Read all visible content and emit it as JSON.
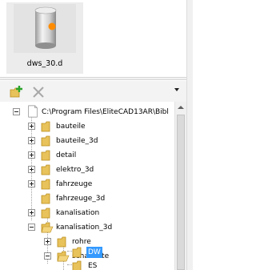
{
  "preview": {
    "thumbnail_label": "dws_30.d"
  },
  "toolbar": {
    "add_folder_icon": "folder-add-icon",
    "delete_icon": "delete-x-icon",
    "dropdown_icon": "dropdown-arrow-icon"
  },
  "tree": {
    "root_label": "C:\\Program Files\\EliteCAD13AR\\Bibl",
    "items": [
      {
        "label": "bauteile",
        "expanded": false
      },
      {
        "label": "bauteile_3d",
        "expanded": false
      },
      {
        "label": "detail",
        "expanded": false
      },
      {
        "label": "elektro_3d",
        "expanded": false
      },
      {
        "label": "fahrzeuge",
        "expanded": false
      },
      {
        "label": "fahrzeuge_3d",
        "expanded": false
      },
      {
        "label": "kanalisation",
        "expanded": false
      },
      {
        "label": "kanalisation_3d",
        "expanded": true
      }
    ],
    "kanal3d_children": [
      {
        "label": "rohre",
        "expanded": false
      },
      {
        "label": "schaechte",
        "expanded": true
      }
    ],
    "schaechte_children": [
      {
        "label": "DW",
        "selected": true
      },
      {
        "label": "ES",
        "selected": false
      }
    ]
  },
  "colors": {
    "selection": "#3399ff",
    "folder": "#e8c25a",
    "cylinder_accent": "#ff8c00"
  }
}
